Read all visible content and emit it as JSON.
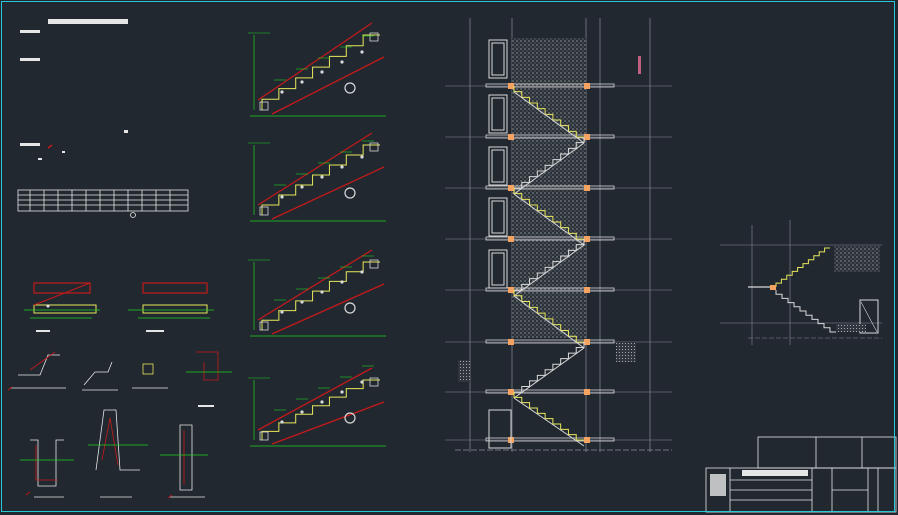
{
  "drawing": {
    "title_block_label": "",
    "notes_heading": "",
    "section_labels": []
  },
  "colors": {
    "background": "#212830",
    "frame": "#29c6d6",
    "rebar": "#c41a1a",
    "stair_outline": "#e8e85a",
    "dimension": "#21d221",
    "structure": "#d9d9d9",
    "wall_hatch": "#bfbfbf",
    "landing_beam": "#f4a460",
    "grid": "#8a8a9a"
  }
}
